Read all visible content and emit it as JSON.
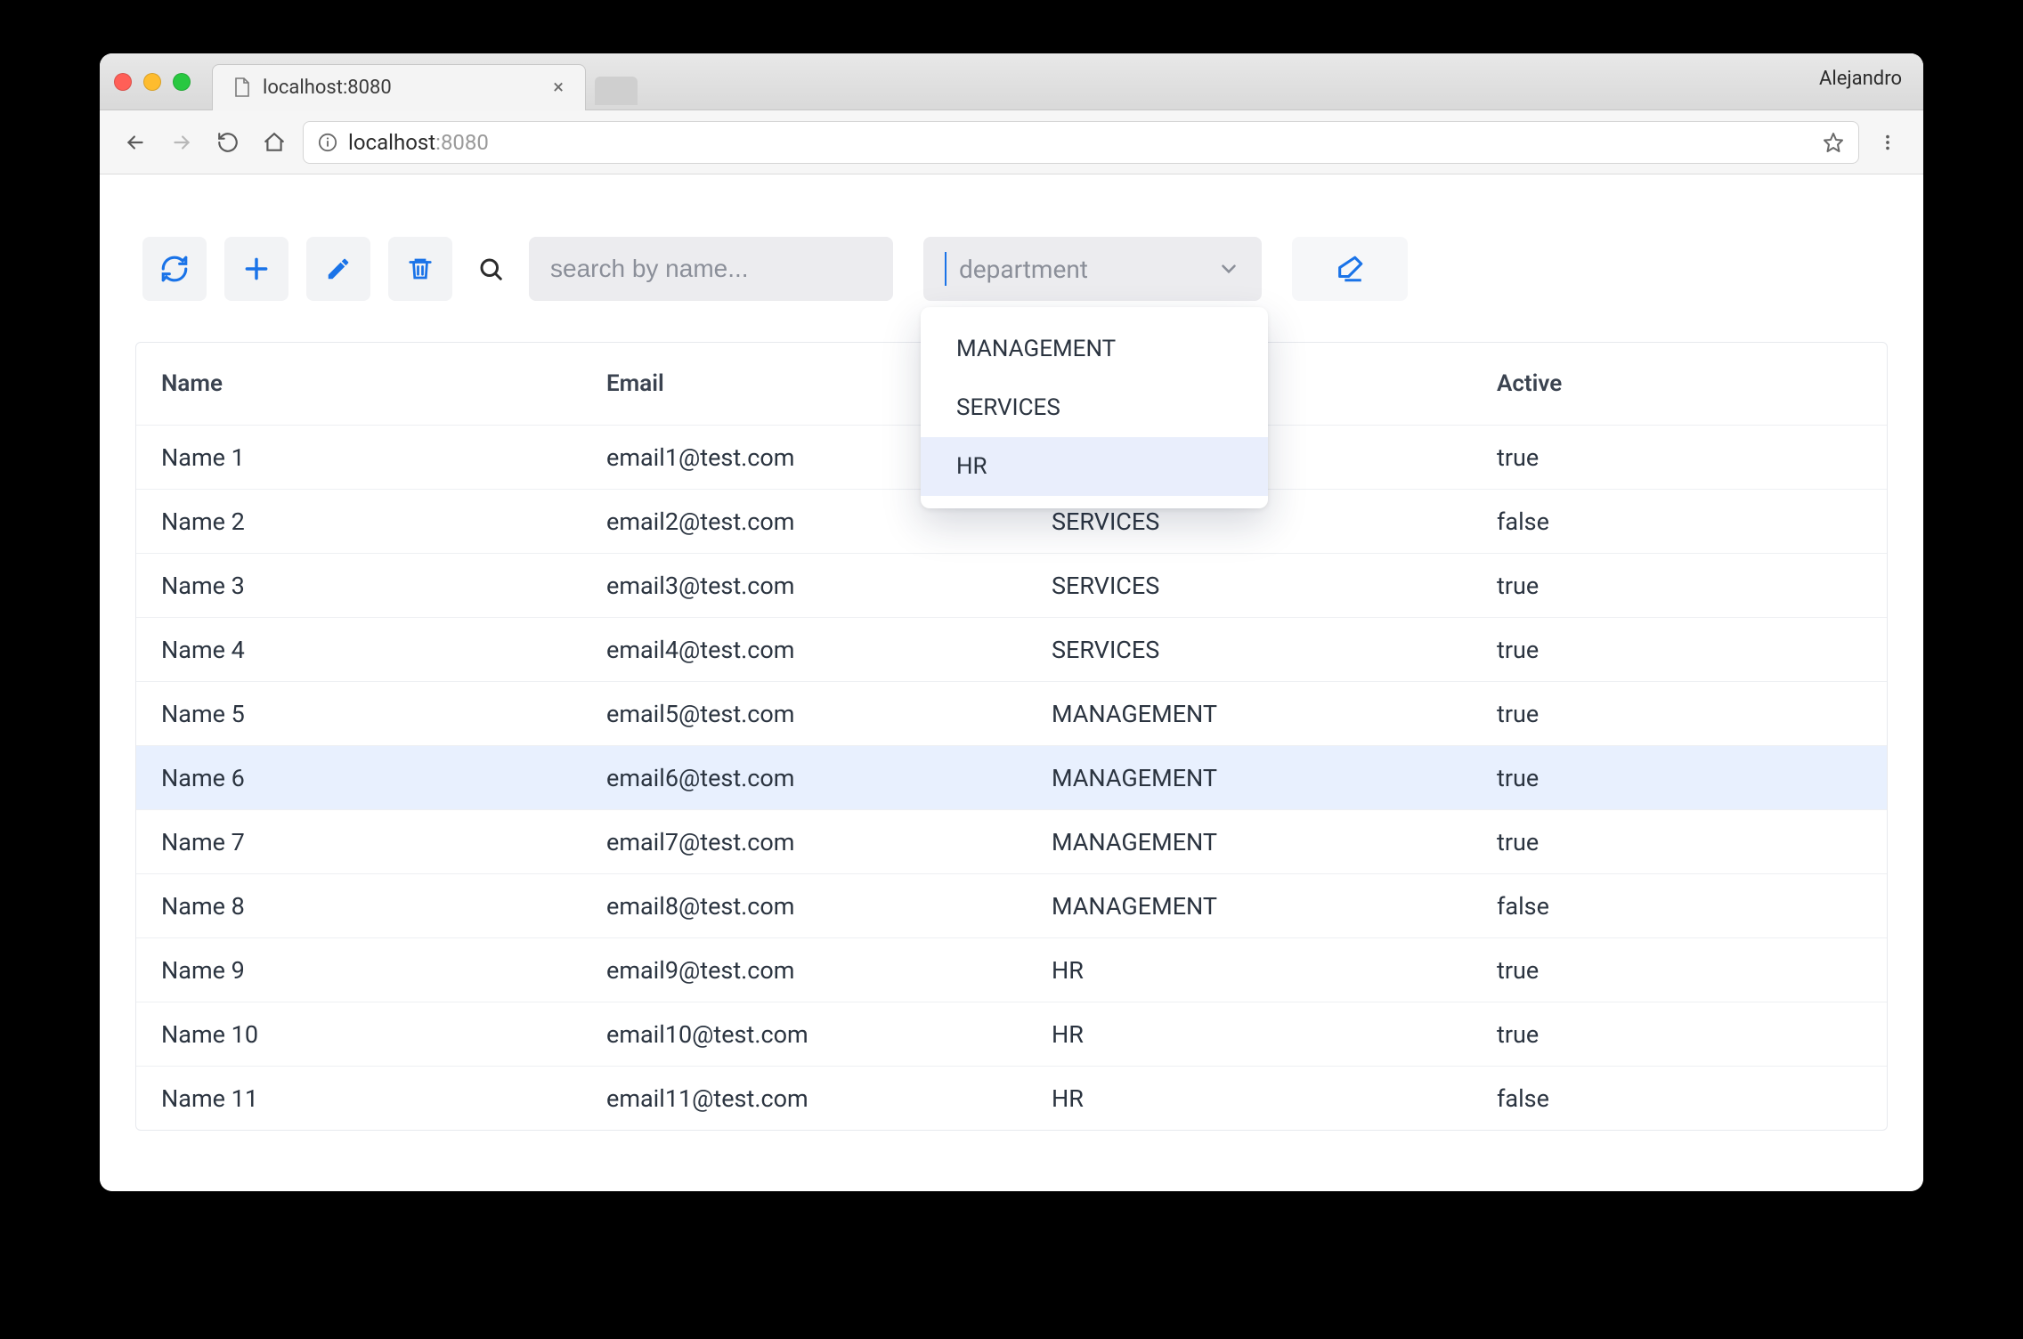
{
  "browser": {
    "tab_title": "localhost:8080",
    "profile": "Alejandro",
    "url_host": "localhost",
    "url_port": ":8080"
  },
  "toolbar": {
    "search_placeholder": "search by name...",
    "department_placeholder": "department",
    "department_options": [
      "MANAGEMENT",
      "SERVICES",
      "HR"
    ],
    "department_highlight_index": 2
  },
  "table": {
    "columns": [
      "Name",
      "Email",
      "",
      "Active"
    ],
    "department_header_hidden": true,
    "selected_index": 5,
    "rows": [
      {
        "name": "Name 1",
        "email": "email1@test.com",
        "department": "",
        "active": "true"
      },
      {
        "name": "Name 2",
        "email": "email2@test.com",
        "department": "SERVICES",
        "active": "false"
      },
      {
        "name": "Name 3",
        "email": "email3@test.com",
        "department": "SERVICES",
        "active": "true"
      },
      {
        "name": "Name 4",
        "email": "email4@test.com",
        "department": "SERVICES",
        "active": "true"
      },
      {
        "name": "Name 5",
        "email": "email5@test.com",
        "department": "MANAGEMENT",
        "active": "true"
      },
      {
        "name": "Name 6",
        "email": "email6@test.com",
        "department": "MANAGEMENT",
        "active": "true"
      },
      {
        "name": "Name 7",
        "email": "email7@test.com",
        "department": "MANAGEMENT",
        "active": "true"
      },
      {
        "name": "Name 8",
        "email": "email8@test.com",
        "department": "MANAGEMENT",
        "active": "false"
      },
      {
        "name": "Name 9",
        "email": "email9@test.com",
        "department": "HR",
        "active": "true"
      },
      {
        "name": "Name 10",
        "email": "email10@test.com",
        "department": "HR",
        "active": "true"
      },
      {
        "name": "Name 11",
        "email": "email11@test.com",
        "department": "HR",
        "active": "false"
      }
    ]
  }
}
